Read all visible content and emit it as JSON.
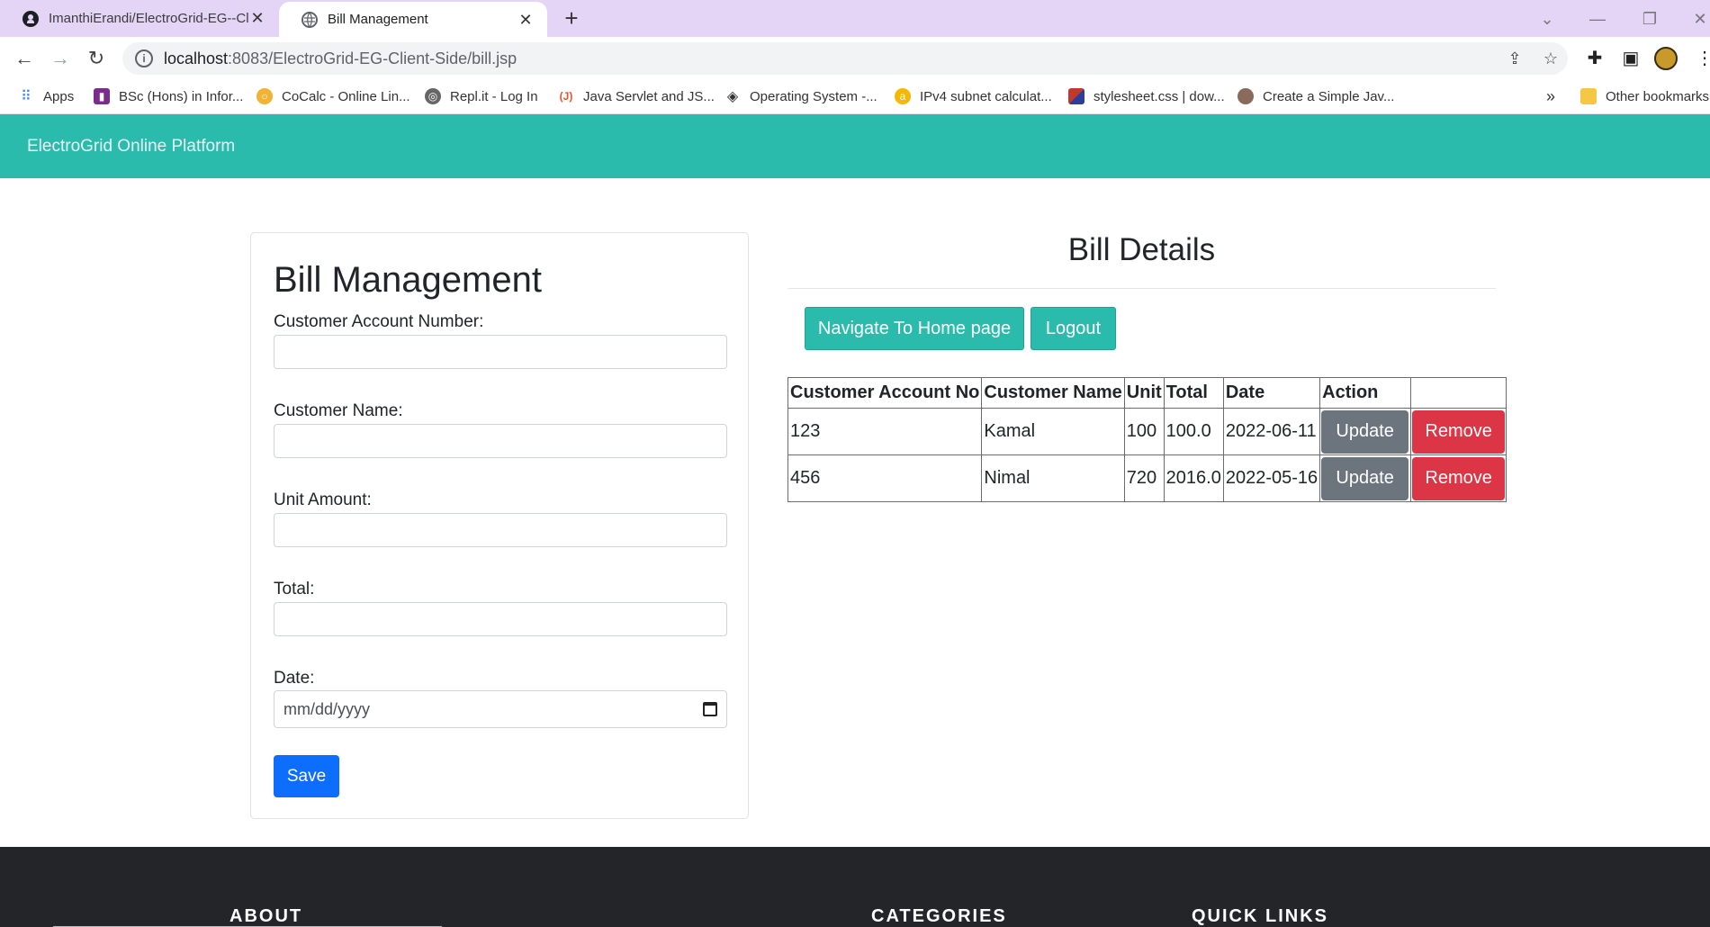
{
  "browser": {
    "tabs": [
      {
        "title": "ImanthiErandi/ElectroGrid-EG--Cl",
        "favicon": "github-icon"
      },
      {
        "title": "Bill Management",
        "favicon": "globe-icon"
      }
    ],
    "address": {
      "host": "localhost",
      "path": ":8083/ElectroGrid-EG-Client-Side/bill.jsp"
    },
    "bookmarks": [
      "Apps",
      "BSc (Hons) in Infor...",
      "CoCalc - Online Lin...",
      "Repl.it - Log In",
      "Java Servlet and JS...",
      "Operating System -...",
      "IPv4 subnet calculat...",
      "stylesheet.css | dow...",
      "Create a Simple Jav...",
      "Other bookmarks"
    ],
    "overflow": "»"
  },
  "nav": {
    "brand": "ElectroGrid Online Platform"
  },
  "form": {
    "title": "Bill Management",
    "account_label": "Customer Account Number:",
    "name_label": "Customer Name:",
    "unit_label": "Unit Amount:",
    "total_label": "Total:",
    "date_label": "Date:",
    "date_placeholder": "mm/dd/yyyy",
    "save_label": "Save"
  },
  "details": {
    "title": "Bill Details",
    "home_button": "Navigate To Home page",
    "logout_button": "Logout",
    "columns": [
      "Customer Account No",
      "Customer Name",
      "Unit",
      "Total",
      "Date",
      "Action",
      ""
    ],
    "rows": [
      {
        "account": "123",
        "name": "Kamal",
        "unit": "100",
        "total": "100.0",
        "date": "2022-06-11",
        "update": "Update",
        "remove": "Remove"
      },
      {
        "account": "456",
        "name": "Nimal",
        "unit": "720",
        "total": "2016.0",
        "date": "2022-05-16",
        "update": "Update",
        "remove": "Remove"
      }
    ]
  },
  "footer": {
    "about": "ABOUT",
    "categories": "CATEGORIES",
    "quick_links": "QUICK LINKS"
  },
  "colors": {
    "nav": "#2bbbad",
    "primary": "#0d6efd",
    "secondary": "#6c757d",
    "danger": "#dc3545",
    "footer": "#232529"
  }
}
